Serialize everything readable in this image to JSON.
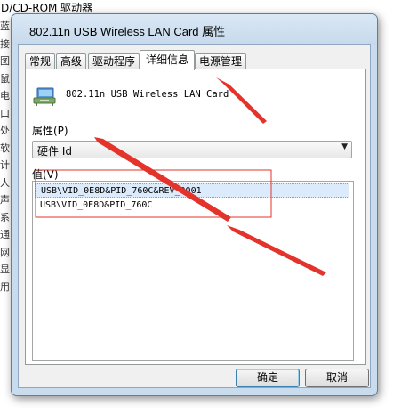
{
  "background_window": {
    "header_text": "D/CD-ROM 驱动器",
    "side_glyphs": [
      "蓝",
      "接",
      "图",
      "鼠",
      "电",
      "口",
      "处",
      "软",
      "计",
      "人",
      "声",
      "系",
      "通",
      "网",
      "显",
      "用"
    ]
  },
  "dialog": {
    "title": "802.11n USB Wireless LAN Card 属性",
    "tabs": [
      {
        "label": "常规"
      },
      {
        "label": "高级"
      },
      {
        "label": "驱动程序"
      },
      {
        "label": "详细信息"
      },
      {
        "label": "电源管理"
      }
    ],
    "active_tab": "详细信息",
    "device_name": "802.11n USB Wireless LAN Card",
    "property_label": "属性(P)",
    "property_value": "硬件 Id",
    "value_label": "值(V)",
    "values": [
      "USB\\VID_0E8D&PID_760C&REV_0001",
      "USB\\VID_0E8D&PID_760C"
    ],
    "ok_label": "确定",
    "cancel_label": "取消"
  },
  "colors": {
    "annotation": "#e4332b",
    "selection": "#dcebfc",
    "titlebar": "#c9dcee"
  }
}
